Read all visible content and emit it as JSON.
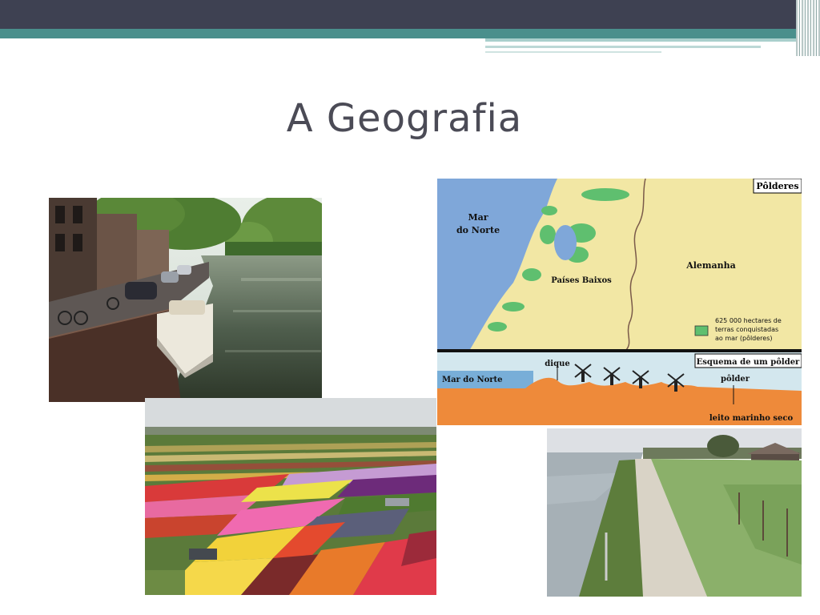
{
  "slide": {
    "title": "A Geografia"
  },
  "map": {
    "corner_label": "Pôlderes",
    "sea_label_line1": "Mar",
    "sea_label_line2": "do Norte",
    "country_label": "Países Baixos",
    "neighbor_label": "Alemanha",
    "legend_line1": "625 000 hectares de",
    "legend_line2": "terras conquistadas",
    "legend_line3": "ao mar (pôlderes)",
    "section_label": "Esquema de um pôlder",
    "dike_label": "dique",
    "sea_section_label": "Mar do Norte",
    "polder_label": "pôlder",
    "seabed_label": "leito marinho seco"
  },
  "colors": {
    "header": "#3e4152",
    "teal": "#4a8f8c",
    "title_text": "#4b4b56"
  }
}
